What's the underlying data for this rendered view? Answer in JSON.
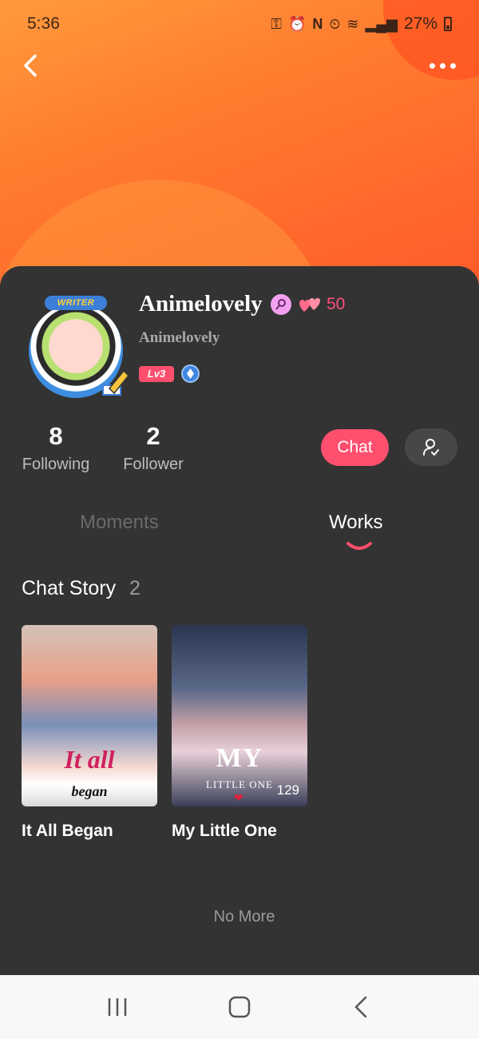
{
  "status_bar": {
    "time": "5:36",
    "battery": "27%",
    "icons": [
      "key-icon",
      "alarm-icon",
      "nfc-icon",
      "clock-icon",
      "wifi-icon",
      "signal-icon",
      "battery-icon"
    ]
  },
  "header": {
    "back_icon": "chevron-left-icon",
    "menu_icon": "more-dots-icon"
  },
  "profile": {
    "badge_label": "WRITER",
    "name": "Animelovely",
    "handle": "Animelovely",
    "hearts": "50",
    "level": "Lv3",
    "gender_icon": "female-icon",
    "verify_icon": "verified-icon"
  },
  "stats": {
    "following_count": "8",
    "following_label": "Following",
    "follower_count": "2",
    "follower_label": "Follower"
  },
  "actions": {
    "chat_label": "Chat",
    "follow_icon": "add-friend-icon"
  },
  "tabs": [
    {
      "label": "Moments",
      "active": false
    },
    {
      "label": "Works",
      "active": true
    }
  ],
  "section": {
    "title": "Chat Story",
    "count": "2"
  },
  "stories": [
    {
      "title": "It All Began",
      "cover_line1": "It all",
      "cover_line2": "began",
      "views": ""
    },
    {
      "title": "My Little One",
      "cover_line1": "MY",
      "cover_line2": "LITTLE ONE",
      "views": "129"
    }
  ],
  "footer_text": "No More",
  "colors": {
    "accent": "#ff4f6e",
    "card_bg": "#333333",
    "hero_orange": "#ff7a2e"
  }
}
